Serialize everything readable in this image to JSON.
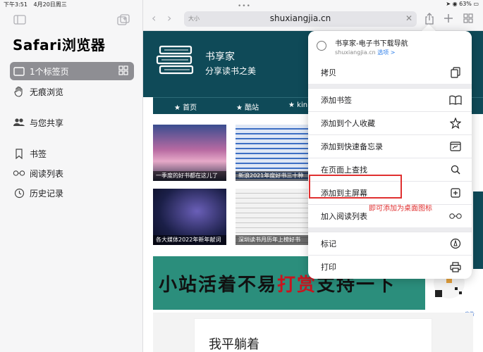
{
  "status_bar": {
    "time": "下午3:51",
    "date": "4月20日周三",
    "battery": "63%"
  },
  "sidebar": {
    "title": "Safari浏览器",
    "items": [
      {
        "label": "1个标签页",
        "icon": "tab-icon",
        "active": true
      },
      {
        "label": "无痕浏览",
        "icon": "hand-icon"
      },
      {
        "label": "与您共享",
        "icon": "shared-people-icon"
      },
      {
        "label": "书签",
        "icon": "bookmark-icon"
      },
      {
        "label": "阅读列表",
        "icon": "glasses-icon"
      },
      {
        "label": "历史记录",
        "icon": "clock-icon"
      }
    ]
  },
  "toolbar": {
    "text_size": "大小",
    "url": "shuxiangjia.cn"
  },
  "website": {
    "name": "书享家",
    "tagline": "分享读书之美",
    "nav": [
      "首页",
      "酷站",
      "kin"
    ],
    "thumbnails": [
      {
        "caption": "一季度的好书都在这儿了"
      },
      {
        "caption": "新浪2021年度好书三十种"
      },
      {
        "caption": "各大媒体2022年新年献词"
      },
      {
        "caption": "深圳读书月历年上榜好书"
      }
    ],
    "banner": {
      "text_start": "小站活着不易",
      "text_red": "打赏",
      "text_end": "支持一下"
    },
    "ad_label": "广告",
    "book_card_title": "我平躺着"
  },
  "share_menu": {
    "site_title": "书享家-电子书下载导航",
    "site_domain": "shuxiangjia.cn",
    "options_label": "选项 >",
    "items": [
      {
        "label": "拷贝",
        "icon": "copy-icon"
      },
      {
        "label": "添加书签",
        "icon": "book-icon"
      },
      {
        "label": "添加到个人收藏",
        "icon": "star-icon"
      },
      {
        "label": "添加到快速备忘录",
        "icon": "quick-note-icon"
      },
      {
        "label": "在页面上查找",
        "icon": "search-icon"
      },
      {
        "label": "添加到主屏幕",
        "icon": "add-square-icon"
      },
      {
        "label": "加入阅读列表",
        "icon": "glasses-icon"
      },
      {
        "label": "标记",
        "icon": "markup-icon"
      },
      {
        "label": "打印",
        "icon": "printer-icon"
      }
    ]
  },
  "annotation": {
    "callout": "即可添加为桌面图标",
    "color": "#e03030"
  }
}
